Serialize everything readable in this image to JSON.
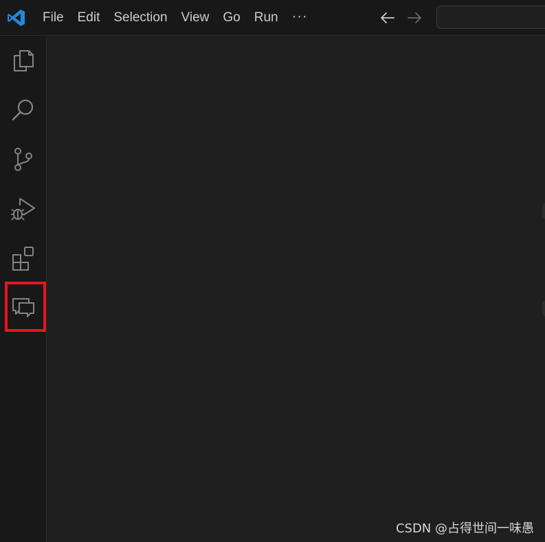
{
  "menubar": {
    "items": [
      "File",
      "Edit",
      "Selection",
      "View",
      "Go",
      "Run"
    ],
    "more_label": "···"
  },
  "activitybar": {
    "items": [
      {
        "icon": "files-icon"
      },
      {
        "icon": "search-icon"
      },
      {
        "icon": "source-control-icon"
      },
      {
        "icon": "run-debug-icon"
      },
      {
        "icon": "extensions-icon"
      },
      {
        "icon": "chat-icon",
        "highlighted": true
      }
    ]
  },
  "colors": {
    "titlebar_bg": "#181818",
    "editor_bg": "#1f1f1f",
    "icon": "#858585",
    "highlight": "#e8141f",
    "logo": "#2489db"
  },
  "watermark": "CSDN @占得世间一味愚"
}
